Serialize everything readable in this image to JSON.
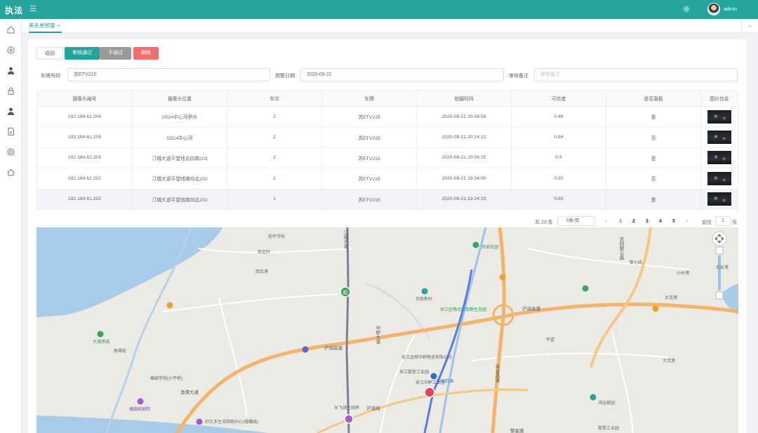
{
  "app": {
    "title": "执法",
    "user": "admin"
  },
  "tabs": [
    {
      "label": "黑名单预警",
      "close": "×"
    }
  ],
  "buttons": {
    "back": "返回",
    "pass": "审核通过",
    "fail": "不通过",
    "delete": "删除"
  },
  "filters": {
    "plate_label": "车牌号码",
    "plate_value": "苏ETV215",
    "date_label": "预警日期",
    "date_value": "2020-09-21",
    "remark_label": "审核备注",
    "remark_placeholder": "审核备注"
  },
  "table": {
    "headers": [
      "摄像头编号",
      "摄像头位置",
      "车次",
      "车牌",
      "拍摄时间",
      "可信度",
      "是否漏报",
      "图片信息"
    ],
    "rows": [
      [
        "192.184.61.204",
        "G524中心河桥头",
        "2",
        "苏ETV215",
        "2020-09-21 20:48:58",
        "0.88",
        "是"
      ],
      [
        "192.184.61.205",
        "G524中心河",
        "2",
        "苏ETV215",
        "2020-09-21 20:14:12",
        "0.84",
        "否"
      ],
      [
        "192.184.61.203",
        "汀城大道平望线北向南203",
        "2",
        "苏ETV215",
        "2020-09-21 20:06:15",
        "0.9",
        "是"
      ],
      [
        "192.184.61.202",
        "汀城大道平望线南向北202",
        "2",
        "苏ETV215",
        "2020-09-21 19:34:00",
        "0.92",
        "否"
      ],
      [
        "192.184.61.202",
        "汀城大道平望线南向北202",
        "1",
        "苏ETV215",
        "2020-09-21 19:24:33",
        "0.65",
        "是"
      ]
    ]
  },
  "pagination": {
    "total": "共 23 条",
    "page_size": "5条/页",
    "pages": [
      "1",
      "2",
      "3",
      "4",
      "5"
    ],
    "current": "1",
    "goto_label": "前往",
    "goto_value": "1",
    "goto_suffix": "页"
  },
  "map": {
    "labels": [
      {
        "t": "江城大道",
        "cls": "road"
      },
      {
        "t": "苏同黎公路",
        "cls": "road"
      },
      {
        "t": "沪渝高速",
        "cls": "road"
      },
      {
        "t": "沪渝高速",
        "cls": "road"
      },
      {
        "t": "中鲈大道",
        "cls": "road"
      },
      {
        "t": "常台高速",
        "cls": "road"
      },
      {
        "t": "沪渝线",
        "cls": "road"
      },
      {
        "t": "黎星路",
        "cls": "road"
      },
      {
        "t": "渔港大道",
        "cls": "road"
      },
      {
        "t": "长飞湖主线桥",
        "cls": "road"
      },
      {
        "t": "大浦港湖",
        "cls": "green"
      },
      {
        "t": "梅堰街",
        "cls": ""
      },
      {
        "t": "横扇学校(小平桥)",
        "cls": ""
      },
      {
        "t": "横扇影剧院",
        "cls": "purple"
      },
      {
        "t": "好又多生活购物中心(城横线)",
        "cls": ""
      },
      {
        "t": "吴江区梅北区南野生态园",
        "cls": "green"
      },
      {
        "t": "东航新村",
        "cls": ""
      },
      {
        "t": "铁坡花园",
        "cls": "green"
      },
      {
        "t": "吴江金辉中鲈物流有限公司",
        "cls": ""
      },
      {
        "t": "吴江黎里工业园",
        "cls": ""
      },
      {
        "t": "吴江中鲈工业园",
        "cls": ""
      },
      {
        "t": "中国石油",
        "cls": "blue"
      },
      {
        "t": "鸿运家园",
        "cls": ""
      },
      {
        "t": "黎里工业园",
        "cls": ""
      },
      {
        "t": "前坪学校",
        "cls": ""
      },
      {
        "t": "南北村",
        "cls": ""
      },
      {
        "t": "西北港",
        "cls": ""
      },
      {
        "t": "大连港",
        "cls": ""
      },
      {
        "t": "黎七线",
        "cls": ""
      },
      {
        "t": "大沈港",
        "cls": ""
      },
      {
        "t": "小长港",
        "cls": ""
      },
      {
        "t": "东长港",
        "cls": ""
      },
      {
        "t": "平望",
        "cls": ""
      }
    ]
  }
}
